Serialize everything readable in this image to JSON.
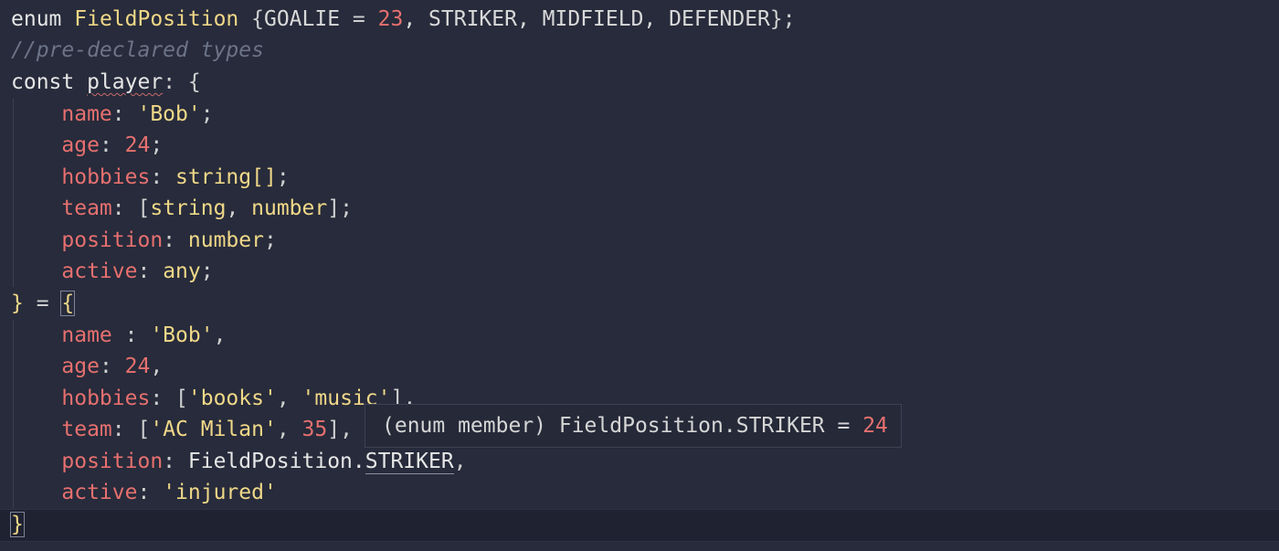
{
  "editor": {
    "lines": {
      "l1": {
        "kw": "enum",
        "name": "FieldPosition",
        "open": "{",
        "m1": "GOALIE",
        "eq": " = ",
        "num": "23",
        "rest": ", STRIKER, MIDFIELD, DEFENDER",
        "close": "};"
      },
      "l2": {
        "comment": "//pre-declared types"
      },
      "l3": {
        "kw": "const",
        "var": "player",
        "tail": ": {"
      },
      "l4": {
        "prop": "name",
        "sep": ": ",
        "val": "'Bob'",
        "end": ";"
      },
      "l5": {
        "prop": "age",
        "sep": ": ",
        "val": "24",
        "end": ";"
      },
      "l6": {
        "prop": "hobbies",
        "sep": ": ",
        "val": "string[]",
        "end": ";"
      },
      "l7": {
        "prop": "team",
        "sep": ": ",
        "open": "[",
        "t1": "string",
        "comma": ", ",
        "t2": "number",
        "close": "]",
        "end": ";"
      },
      "l8": {
        "prop": "position",
        "sep": ": ",
        "val": "number",
        "end": ";"
      },
      "l9": {
        "prop": "active",
        "sep": ": ",
        "val": "any",
        "end": ";"
      },
      "l10": {
        "close": "}",
        "eq": " = ",
        "open": "{"
      },
      "l11": {
        "prop": "name",
        "sep": " : ",
        "val": "'Bob'",
        "end": ","
      },
      "l12": {
        "prop": "age",
        "sep": ": ",
        "val": "24",
        "end": ","
      },
      "l13": {
        "prop": "hobbies",
        "sep": ": ",
        "open": "[",
        "v1": "'books'",
        "comma": ", ",
        "v2": "'music'",
        "close": "]",
        "end": ","
      },
      "l14": {
        "prop": "team",
        "sep": ": ",
        "open": "[",
        "v1": "'AC Milan'",
        "comma": ", ",
        "v2": "35",
        "close": "]",
        "end": ","
      },
      "l15": {
        "prop": "position",
        "sep": ": ",
        "obj": "FieldPosition.",
        "member": "STRIKER",
        "end": ","
      },
      "l16": {
        "prop": "active",
        "sep": ": ",
        "val": "'injured'"
      },
      "l17": {
        "close": "}"
      }
    }
  },
  "tooltip": {
    "label": "(enum member) FieldPosition.STRIKER = ",
    "value": "24"
  }
}
